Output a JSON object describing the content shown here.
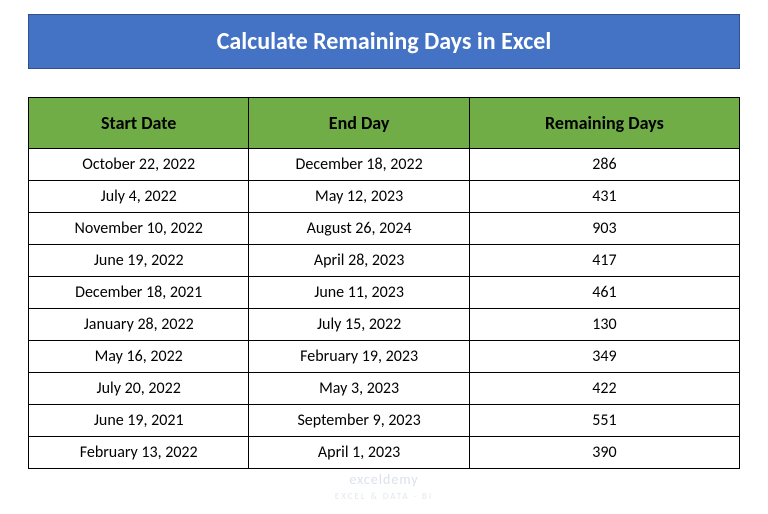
{
  "title": "Calculate Remaining Days in Excel",
  "headers": {
    "start": "Start Date",
    "end": "End Day",
    "remaining": "Remaining Days"
  },
  "rows": [
    {
      "start": "October 22, 2022",
      "end": "December 18, 2022",
      "remaining": "286"
    },
    {
      "start": "July 4, 2022",
      "end": "May 12, 2023",
      "remaining": "431"
    },
    {
      "start": "November 10, 2022",
      "end": "August 26, 2024",
      "remaining": "903"
    },
    {
      "start": "June 19, 2022",
      "end": "April 28, 2023",
      "remaining": "417"
    },
    {
      "start": "December 18, 2021",
      "end": "June 11, 2023",
      "remaining": "461"
    },
    {
      "start": "January 28, 2022",
      "end": "July 15, 2022",
      "remaining": "130"
    },
    {
      "start": "May 16, 2022",
      "end": "February 19, 2023",
      "remaining": "349"
    },
    {
      "start": "July 20, 2022",
      "end": "May 3, 2023",
      "remaining": "422"
    },
    {
      "start": "June 19, 2021",
      "end": "September 9, 2023",
      "remaining": "551"
    },
    {
      "start": "February 13, 2022",
      "end": "April 1, 2023",
      "remaining": "390"
    }
  ],
  "watermark": {
    "main": "exceldemy",
    "sub": "EXCEL & DATA · BI"
  }
}
